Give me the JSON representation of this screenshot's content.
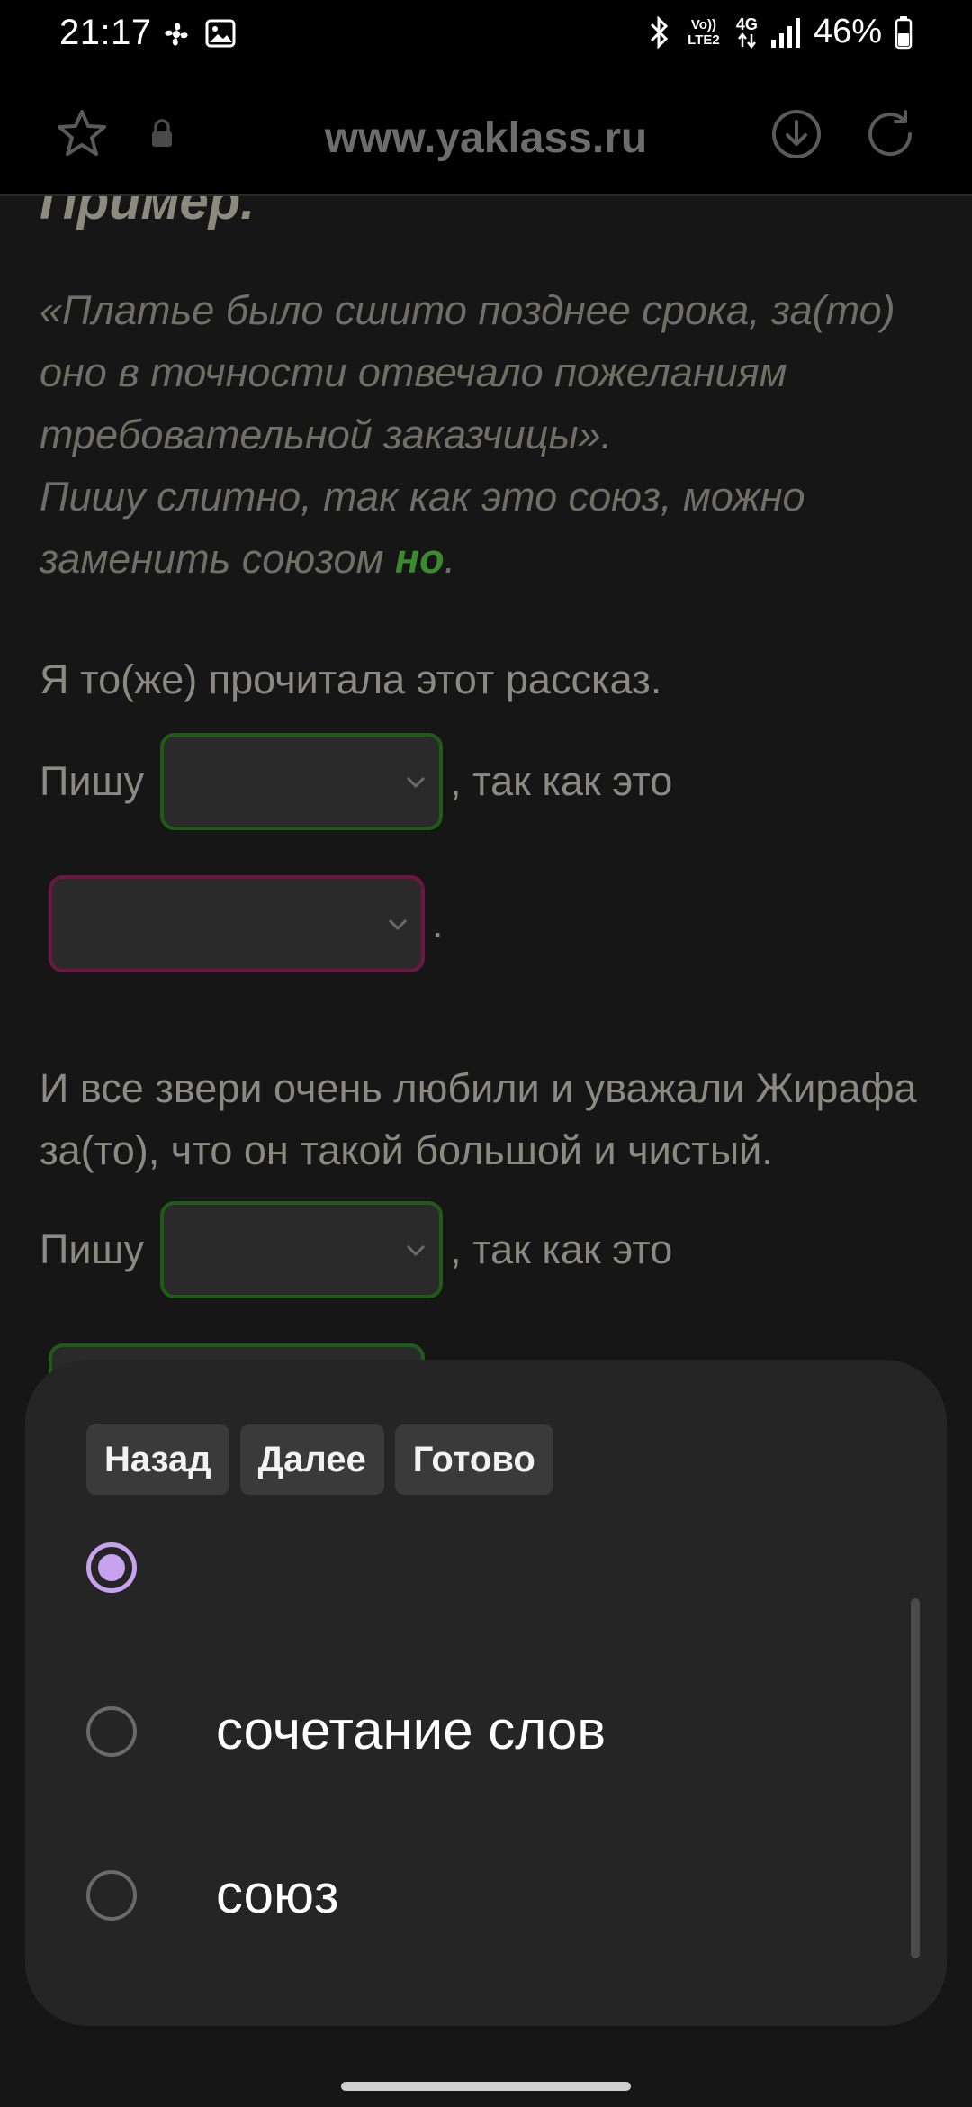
{
  "status_bar": {
    "time": "21:17",
    "lte_label": "Vo)) LTE2",
    "net_label": "4G",
    "battery": "46%"
  },
  "browser": {
    "url": "www.yaklass.ru"
  },
  "content": {
    "heading": "Пример.",
    "example_quote": "«Платье было сшито позднее срока, за(то) оно в точности отвечало пожеланиям требовательной заказчицы».",
    "example_explanation_prefix": "Пишу слитно, так как это союз, можно заменить союзом ",
    "example_highlight": "но",
    "example_explanation_suffix": ".",
    "task1": {
      "sentence": "Я то(же) прочитала этот рассказ.",
      "prefix": "Пишу",
      "middle": ", так как это",
      "suffix": "."
    },
    "task2": {
      "sentence": "И все звери очень любили и уважали Жирафа за(то), что он такой большой и чистый.",
      "prefix": "Пишу",
      "middle": ", так как это"
    }
  },
  "picker": {
    "buttons": {
      "back": "Назад",
      "next": "Далее",
      "done": "Готово"
    },
    "options": [
      {
        "label": "",
        "selected": true
      },
      {
        "label": "сочетание слов",
        "selected": false
      },
      {
        "label": "союз",
        "selected": false
      }
    ]
  },
  "colors": {
    "accent_radio": "#c6a1ee",
    "highlight_green": "#3c8a2e",
    "dropdown_green_border": "#1f5c17",
    "dropdown_magenta_border": "#6b1745"
  }
}
